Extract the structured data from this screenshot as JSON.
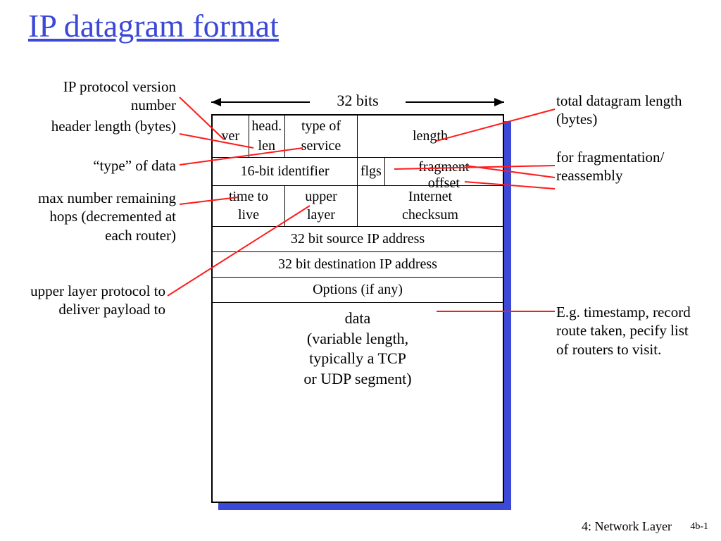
{
  "title": "IP datagram format",
  "ruler": "32 bits",
  "footer": {
    "section": "4: Network Layer",
    "page": "4b-1"
  },
  "fields": {
    "ver": "ver",
    "hlen_top": "head.",
    "hlen_bot": "len",
    "tos_top": "type of",
    "tos_bot": "service",
    "length": "length",
    "ident": "16-bit identifier",
    "flgs": "flgs",
    "frag_top": "fragment",
    "frag_bot": "offset",
    "ttl_top": "time to",
    "ttl_bot": "live",
    "ulp_top": "upper",
    "ulp_bot": "layer",
    "cksum_top": "Internet",
    "cksum_bot": "checksum",
    "src": "32 bit source IP address",
    "dst": "32 bit destination IP address",
    "opts": "Options (if any)",
    "data1": "data",
    "data2": "(variable length,",
    "data3": "typically a TCP",
    "data4": "or UDP segment)"
  },
  "ann": {
    "ver": "IP protocol version number",
    "hlen": "header length (bytes)",
    "tos": "“type” of data",
    "ttl": "max number remaining hops (decremented at each router)",
    "ulp": "upper layer protocol to deliver payload to",
    "length": "total datagram length (bytes)",
    "frag": "for fragmentation/ reassembly",
    "opts": "E.g. timestamp, record route taken, pecify list of routers to visit."
  }
}
